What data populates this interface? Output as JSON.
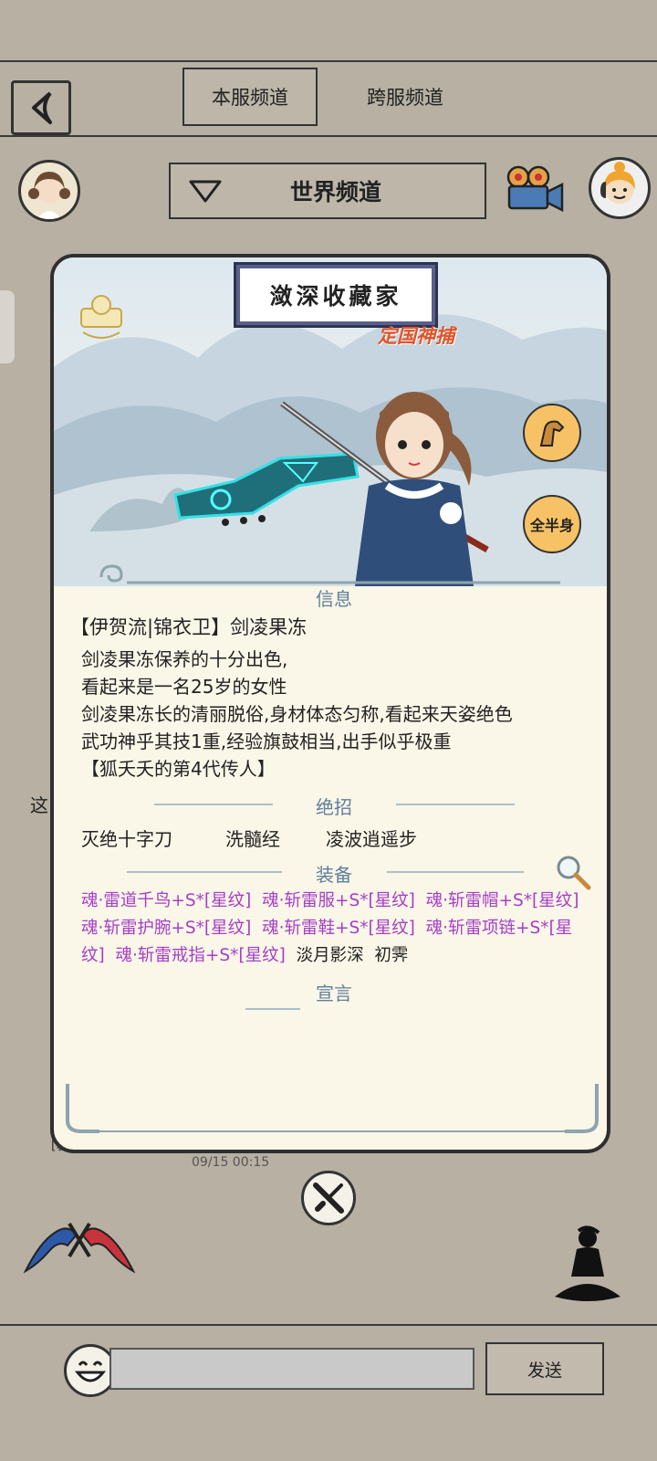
{
  "header": {
    "tabs": [
      {
        "label": "本服频道",
        "active": true
      },
      {
        "label": "跨服频道",
        "active": false
      }
    ],
    "channel_label": "世界频道"
  },
  "profile": {
    "name_plate": "潋深收藏家",
    "title_badge": "定国神捕",
    "side_buttons": {
      "full_half": "全半身"
    },
    "sections": {
      "info": "信息",
      "skills": "绝招",
      "equipment": "装备",
      "declaration": "宣言"
    },
    "identity": "【伊贺流|锦衣卫】剑凌果冻",
    "info_lines": [
      "剑凌果冻保养的十分出色,",
      "看起来是一名25岁的女性",
      "剑凌果冻长的清丽脱俗,身材体态匀称,看起来天姿绝色",
      "武功神乎其技1重,经验旗鼓相当,出手似乎极重",
      "【狐夭夭的第4代传人】"
    ],
    "skills": [
      "灭绝十字刀",
      "洗髓经",
      "凌波逍遥步"
    ],
    "equipment": [
      "魂·雷道千鸟+S*[星纹]",
      "魂·斩雷服+S*[星纹]",
      "魂·斩雷帽+S*[星纹]",
      "魂·斩雷护腕+S*[星纹]",
      "魂·斩雷鞋+S*[星纹]",
      "魂·斩雷项链+S*[星纹]",
      "魂·斩雷戒指+S*[星纹]"
    ],
    "equipment_plain": [
      "淡月影深",
      "初霁"
    ]
  },
  "chat_peek": {
    "fragment_1": "这",
    "fragment_2": "[暮光",
    "timestamp": "09/15 00:15"
  },
  "input_bar": {
    "send_label": "发送"
  },
  "colors": {
    "background": "#b7b0a3",
    "card_bg": "#faf6e8",
    "section_head": "#5f7f9a",
    "equipment": "#a53fc6",
    "title_badge": "#e0542a"
  }
}
